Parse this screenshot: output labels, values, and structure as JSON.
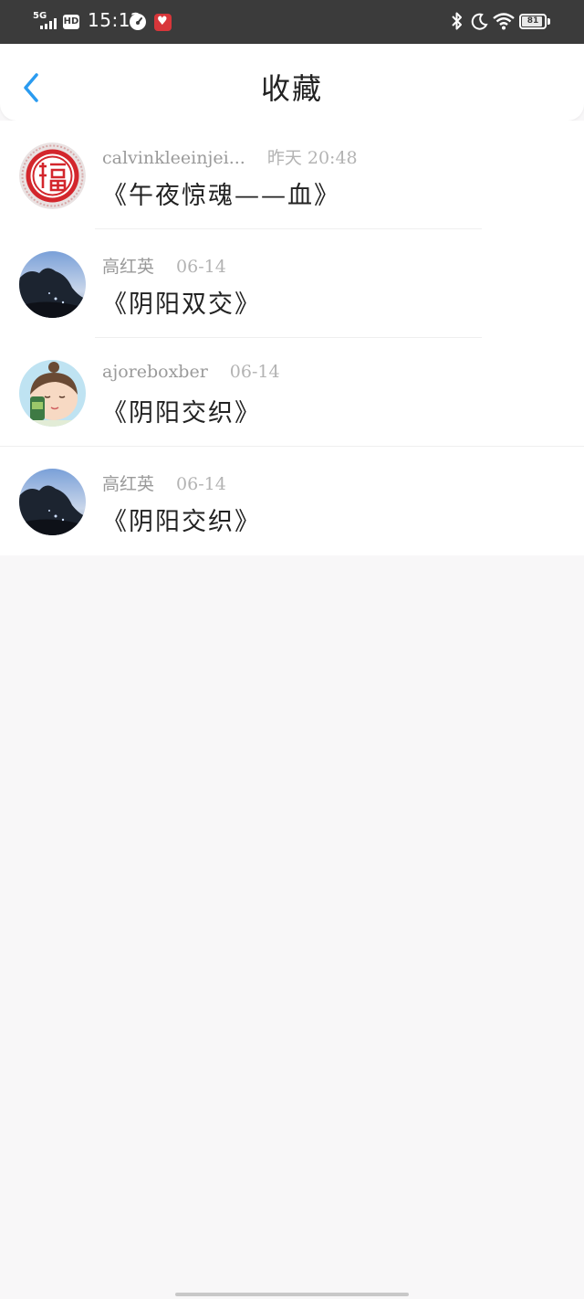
{
  "status_bar": {
    "network": "5G",
    "hd": "HD",
    "time": "15:12",
    "battery": "81"
  },
  "header": {
    "title": "收藏"
  },
  "favorites": [
    {
      "author": "calvinkleeinjei...",
      "time": "昨天 20:48",
      "title": "《午夜惊魂——血》",
      "avatar": "fu-seal-avatar"
    },
    {
      "author": "高红英",
      "time": "06-14",
      "title": "《阴阳双交》",
      "avatar": "night-tree-avatar"
    },
    {
      "author": "ajoreboxber",
      "time": "06-14",
      "title": "《阴阳交织》",
      "avatar": "cartoon-girl-avatar"
    },
    {
      "author": "高红英",
      "time": "06-14",
      "title": "《阴阳交织》",
      "avatar": "night-tree-avatar"
    }
  ],
  "colors": {
    "accent": "#2a9bf0",
    "status_bar_bg": "#3b3b3b",
    "page_bg": "#f8f7f8"
  }
}
